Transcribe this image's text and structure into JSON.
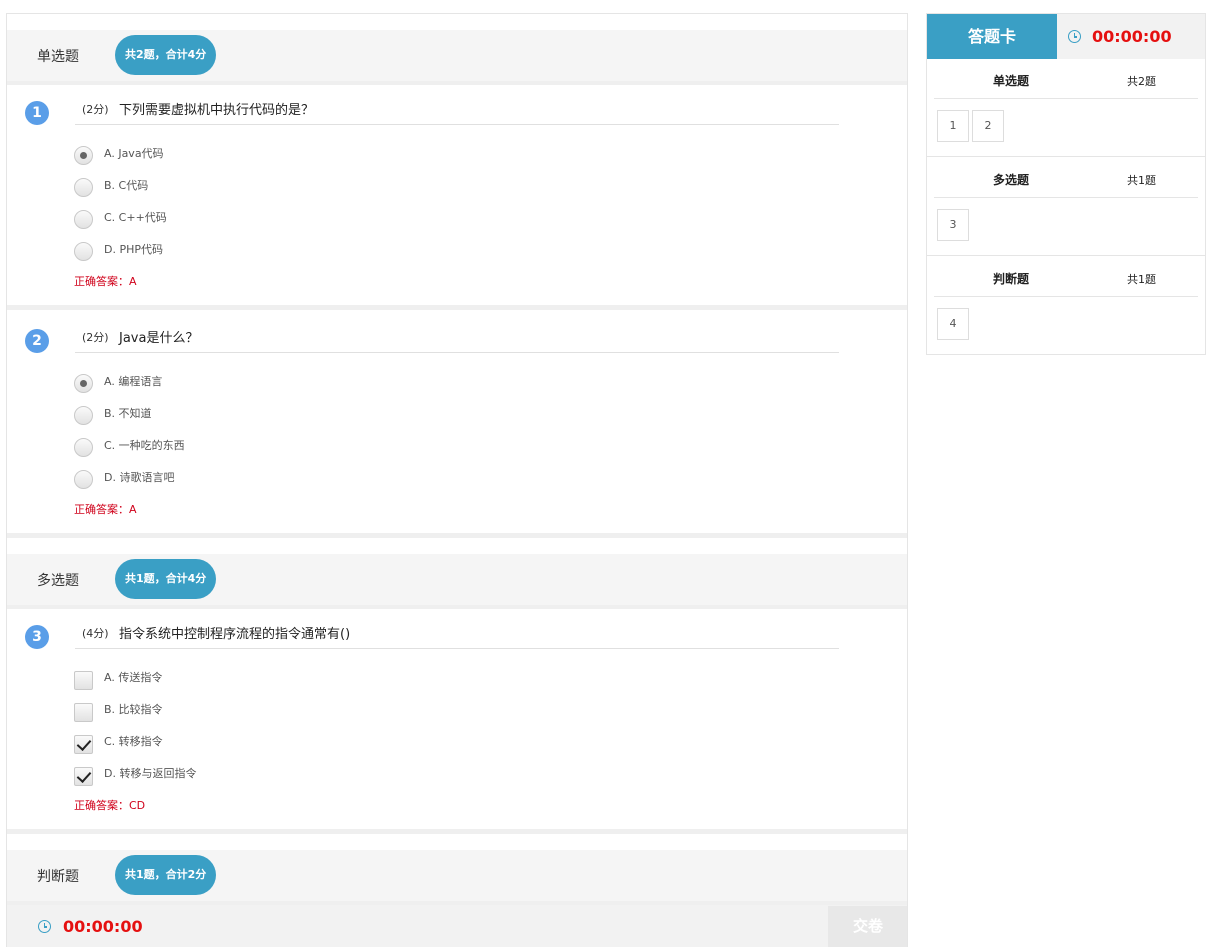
{
  "sections": [
    {
      "title": "单选题",
      "badge": "共2题，合计4分"
    },
    {
      "title": "多选题",
      "badge": "共1题，合计4分"
    },
    {
      "title": "判断题",
      "badge": "共1题，合计2分"
    }
  ],
  "questions": [
    {
      "num": "1",
      "score": "(2分)",
      "text": "下列需要虚拟机中执行代码的是？",
      "options": [
        "A. Java代码",
        "B. C代码",
        "C. C++代码",
        "D. PHP代码"
      ],
      "answer": "正确答案：A"
    },
    {
      "num": "2",
      "score": "(2分)",
      "text": "Java是什么？",
      "options": [
        "A. 编程语言",
        "B. 不知道",
        "C. 一种吃的东西",
        "D. 诗歌语言吧"
      ],
      "answer": "正确答案：A"
    },
    {
      "num": "3",
      "score": "(4分)",
      "text": "指令系统中控制程序流程的指令通常有()",
      "options": [
        "A. 传送指令",
        "B. 比较指令",
        "C. 转移指令",
        "D. 转移与返回指令"
      ],
      "answer": "正确答案：CD"
    }
  ],
  "bottom_bar": {
    "timer": "00:00:00",
    "submit_label": "交卷"
  },
  "answer_card": {
    "title": "答题卡",
    "timer": "00:00:00",
    "sections": [
      {
        "title": "单选题",
        "count": "共2题",
        "items": [
          "1",
          "2"
        ]
      },
      {
        "title": "多选题",
        "count": "共1题",
        "items": [
          "3"
        ]
      },
      {
        "title": "判断题",
        "count": "共1题",
        "items": [
          "4"
        ]
      }
    ]
  },
  "icons": {
    "timer": "clock-icon"
  },
  "colors": {
    "accent": "#3a9fc5",
    "question_number": "#5a9ee8",
    "answer": "#d0021b",
    "timer": "#e51010"
  }
}
